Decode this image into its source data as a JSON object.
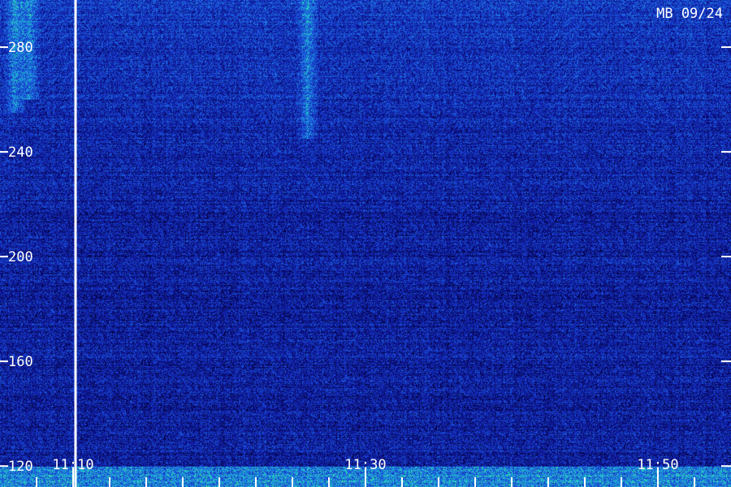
{
  "chart_data": {
    "type": "heatmap",
    "title": "",
    "station_label": "MB 09/24",
    "xlabel": "",
    "ylabel": "",
    "x_time_range": [
      "11:05",
      "11:55"
    ],
    "x_tick_labels": [
      "11:10",
      "11:30",
      "11:50"
    ],
    "x_minor_tick_interval_min": 2.5,
    "y_range": [
      112,
      298
    ],
    "y_tick_values": [
      120,
      160,
      200,
      240,
      280
    ],
    "y_tick_labels": [
      "120",
      "160",
      "200",
      "240",
      "280"
    ],
    "marker_time": "11:10",
    "colormap": [
      "#000010",
      "#0a0a7a",
      "#1632c8",
      "#1e78e6",
      "#23d2c8",
      "#55ff6e"
    ],
    "background_color": "#000000",
    "text_color": "#ffffff",
    "grid": false,
    "description_features": {
      "intense_bands": [
        {
          "time": "11:06",
          "y_range": [
            255,
            298
          ]
        },
        {
          "time": "11:26",
          "y_range": [
            245,
            298
          ]
        },
        {
          "time": "11:07",
          "y_range": [
            260,
            298
          ]
        }
      ],
      "enhanced_rows_y_range": [
        215,
        298
      ],
      "bottom_noise_band_y": [
        112,
        120
      ]
    }
  }
}
